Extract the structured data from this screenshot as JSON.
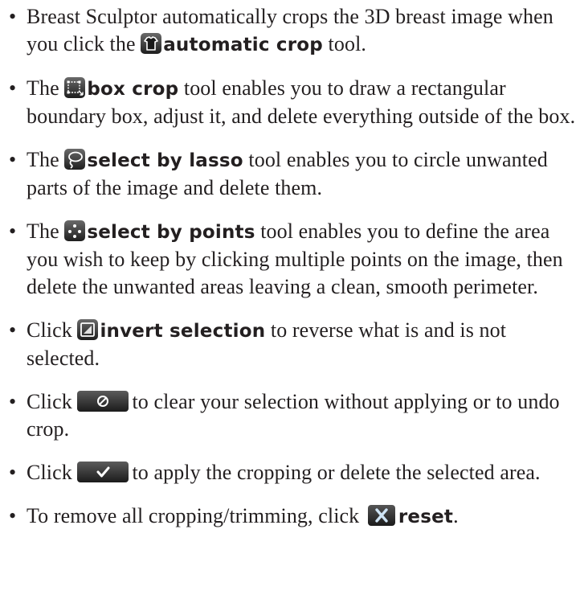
{
  "items": [
    {
      "before": "Breast Sculptor automatically crops the 3D breast image when you click the ",
      "icon": "shirt-icon",
      "term": "automatic crop",
      "after": " tool."
    },
    {
      "before": "The ",
      "icon": "box-crop-icon",
      "term": "box crop",
      "after": " tool enables you to draw a rectangular boundary box, adjust it, and delete everything outside of the box."
    },
    {
      "before": "The ",
      "icon": "lasso-icon",
      "term": "select by lasso",
      "after": " tool enables you to circle unwanted parts of the image and delete them."
    },
    {
      "before": "The ",
      "icon": "points-icon",
      "term": "select by points",
      "after": " tool enables you to define the area you wish to keep by clicking multiple points on the image, then delete the unwanted areas leaving a clean, smooth perimeter."
    },
    {
      "before": "Click ",
      "icon": "invert-selection-icon",
      "term": "invert selection",
      "after": " to reverse what is and is not selected."
    },
    {
      "before": "Click ",
      "icon": "clear-selection-button-icon",
      "after": "to clear your selection without applying or to undo crop."
    },
    {
      "before": "Click ",
      "icon": "apply-checkmark-button-icon",
      "after": "to apply the cropping or delete the selected area."
    },
    {
      "before": "To remove all cropping/trimming, click ",
      "icon": "reset-x-icon",
      "term": "reset",
      "after": "."
    }
  ],
  "bullet": "•"
}
